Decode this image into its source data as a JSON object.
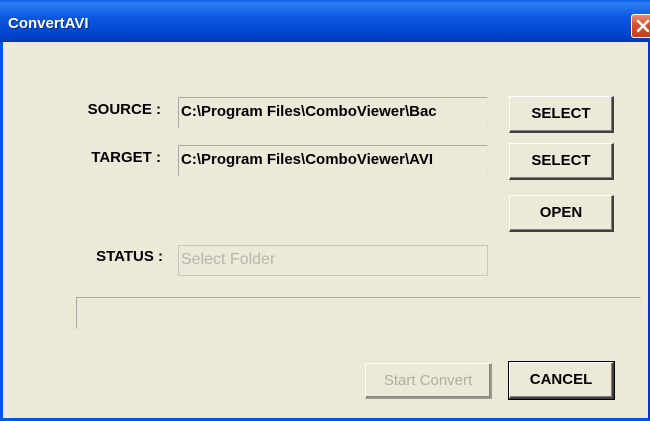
{
  "window": {
    "title": "ConvertAVI"
  },
  "source": {
    "label": "SOURCE :",
    "value": "C:\\Program Files\\ComboViewer\\Bac",
    "select_label": "SELECT"
  },
  "target": {
    "label": "TARGET :",
    "value": "C:\\Program Files\\ComboViewer\\AVI",
    "select_label": "SELECT",
    "open_label": "OPEN"
  },
  "status": {
    "label": "STATUS :",
    "value": "Select Folder"
  },
  "progress": {
    "value": 0
  },
  "actions": {
    "start_label": "Start Convert",
    "cancel_label": "CANCEL"
  },
  "colors": {
    "titlebar": "#0055e5",
    "dialog_bg": "#ece9d8",
    "close_button": "#d9522c"
  }
}
